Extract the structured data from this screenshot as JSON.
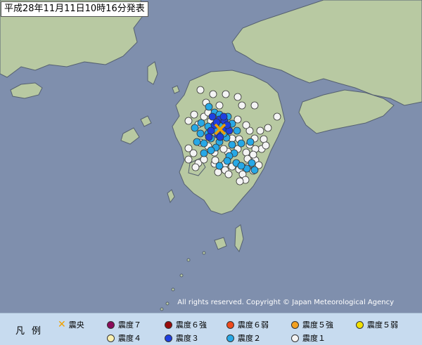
{
  "title": "平成28年11月11日10時16分発表",
  "copyright": "All rights reserved. Copyright © Japan Meteorological Agency",
  "legend": {
    "title_chars": [
      "凡",
      "例"
    ],
    "items": [
      {
        "label": "震央",
        "kind": "epicenter",
        "color": "#f0a000"
      },
      {
        "label": "震度７",
        "kind": "dot",
        "color": "#8a0c5c"
      },
      {
        "label": "震度６強",
        "kind": "dot",
        "color": "#9a0b0b"
      },
      {
        "label": "震度６弱",
        "kind": "dot",
        "color": "#ef4a1c"
      },
      {
        "label": "震度５強",
        "kind": "dot",
        "color": "#f2a020"
      },
      {
        "label": "震度５弱",
        "kind": "dot",
        "color": "#f2e000"
      },
      {
        "label": "震度４",
        "kind": "dot",
        "color": "#f9f0b0"
      },
      {
        "label": "震度３",
        "kind": "dot",
        "color": "#1e3fe0"
      },
      {
        "label": "震度２",
        "kind": "dot",
        "color": "#27a8e6"
      },
      {
        "label": "震度１",
        "kind": "dot",
        "color": "#f4f4f4"
      }
    ]
  },
  "colors": {
    "sea": "#7f8fad",
    "land": "#b8c9a2",
    "coast": "#556070",
    "intensity3": "#1e3fe0",
    "intensity2": "#27a8e6",
    "intensity1": "#f4f4f4",
    "epicenter": "#f0a000"
  }
}
